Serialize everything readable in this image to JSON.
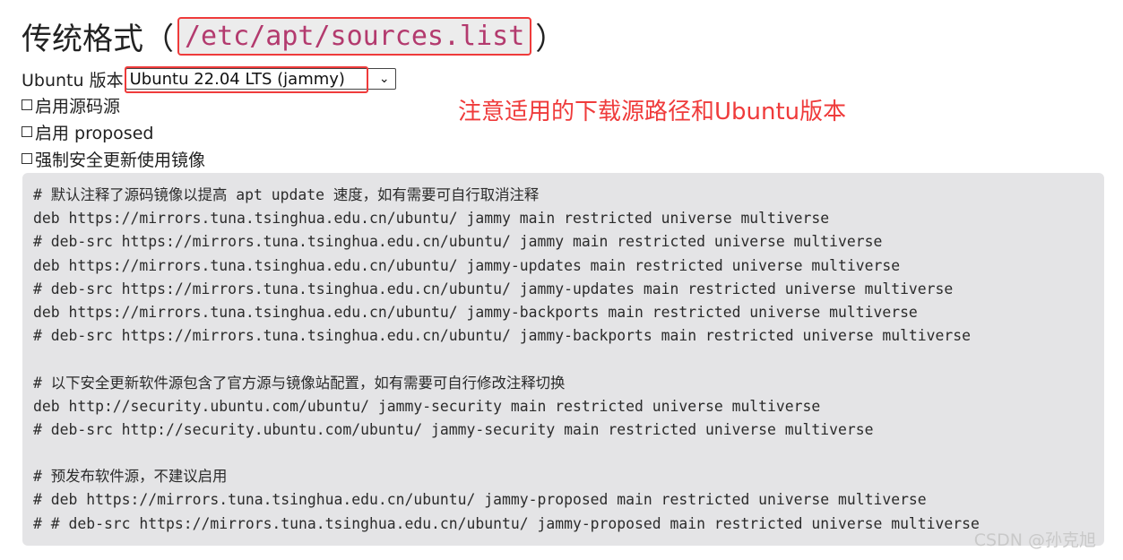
{
  "heading": {
    "prefix": "传统格式（",
    "path": "/etc/apt/sources.list",
    "suffix": "）"
  },
  "version": {
    "label": "Ubuntu 版本",
    "selected": "Ubuntu 22.04 LTS (jammy)"
  },
  "options": [
    {
      "label": "启用源码源",
      "checked": false
    },
    {
      "label": "启用 proposed",
      "checked": false
    },
    {
      "label": "强制安全更新使用镜像",
      "checked": false
    }
  ],
  "annotation": "注意适用的下载源路径和Ubuntu版本",
  "code_lines": [
    "# 默认注释了源码镜像以提高 apt update 速度，如有需要可自行取消注释",
    "deb https://mirrors.tuna.tsinghua.edu.cn/ubuntu/ jammy main restricted universe multiverse",
    "# deb-src https://mirrors.tuna.tsinghua.edu.cn/ubuntu/ jammy main restricted universe multiverse",
    "deb https://mirrors.tuna.tsinghua.edu.cn/ubuntu/ jammy-updates main restricted universe multiverse",
    "# deb-src https://mirrors.tuna.tsinghua.edu.cn/ubuntu/ jammy-updates main restricted universe multiverse",
    "deb https://mirrors.tuna.tsinghua.edu.cn/ubuntu/ jammy-backports main restricted universe multiverse",
    "# deb-src https://mirrors.tuna.tsinghua.edu.cn/ubuntu/ jammy-backports main restricted universe multiverse",
    "",
    "# 以下安全更新软件源包含了官方源与镜像站配置，如有需要可自行修改注释切换",
    "deb http://security.ubuntu.com/ubuntu/ jammy-security main restricted universe multiverse",
    "# deb-src http://security.ubuntu.com/ubuntu/ jammy-security main restricted universe multiverse",
    "",
    "# 预发布软件源，不建议启用",
    "# deb https://mirrors.tuna.tsinghua.edu.cn/ubuntu/ jammy-proposed main restricted universe multiverse",
    "# # deb-src https://mirrors.tuna.tsinghua.edu.cn/ubuntu/ jammy-proposed main restricted universe multiverse"
  ],
  "watermark": "CSDN @孙克旭",
  "colors": {
    "highlight_border": "#ef3b3b",
    "annotation_text": "#ef3b3b",
    "path_text": "#b33a6e",
    "code_background": "#e4e4e6"
  },
  "icons": {
    "dropdown": "chevron-down-icon",
    "checkbox": "checkbox-icon"
  }
}
